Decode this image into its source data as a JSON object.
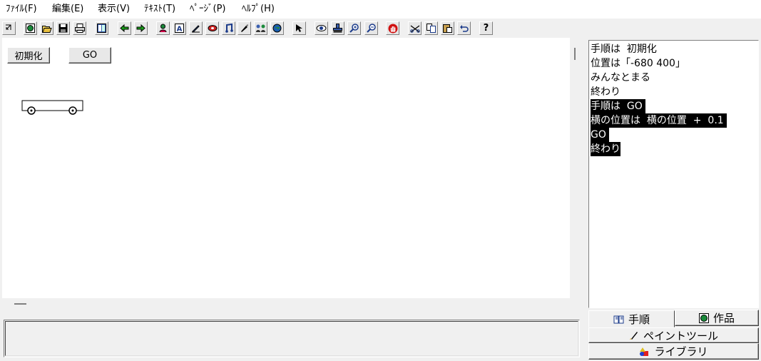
{
  "menu": [
    {
      "id": "file",
      "label": "ﾌｧｲﾙ(F)"
    },
    {
      "id": "edit",
      "label": "編集(E)"
    },
    {
      "id": "view",
      "label": "表示(V)"
    },
    {
      "id": "text",
      "label": "ﾃｷｽﾄ(T)"
    },
    {
      "id": "page",
      "label": "ﾍﾟｰｼﾞ(P)"
    },
    {
      "id": "help",
      "label": "ﾍﾙﾌﾟ(H)"
    }
  ],
  "toolbar": {
    "help_label": "?"
  },
  "stage": {
    "buttons": [
      {
        "label": "初期化"
      },
      {
        "label": "GO"
      }
    ]
  },
  "script": {
    "lines": [
      {
        "text": "手順は  初期化",
        "selected": false
      },
      {
        "text": "位置は「-680 400」",
        "selected": false
      },
      {
        "text": "みんなとまる",
        "selected": false
      },
      {
        "text": "終わり",
        "selected": false
      },
      {
        "text": "手順は  GO ",
        "selected": true
      },
      {
        "text": "横の位置は  横の位置  +  0.1 ",
        "selected": true
      },
      {
        "text": "GO ",
        "selected": true
      },
      {
        "text": "終わり",
        "selected": true
      }
    ]
  },
  "tabs": {
    "procedure": "手順",
    "works": "作品",
    "paint_tool": "ペイントツール",
    "library": "ライブラリ"
  },
  "colors": {
    "background": "#f0f0f0",
    "selection": "#000000",
    "stage": "#ffffff"
  }
}
